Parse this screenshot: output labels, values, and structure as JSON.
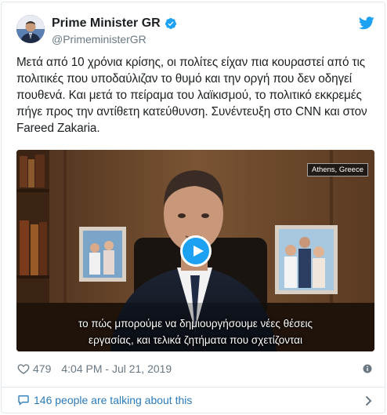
{
  "author": {
    "display_name": "Prime Minister GR",
    "handle": "@PrimeministerGR",
    "verified": true
  },
  "tweet": {
    "text": "Μετά από 10 χρόνια κρίσης, οι πολίτες είχαν πια κουραστεί από τις πολιτικές που υποδαύλιζαν το θυμό και την οργή που δεν οδηγεί πουθενά. Και μετά το πείραμα του λαϊκισμού, το πολιτικό εκκρεμές πήγε προς την αντίθετη κατεύθυνση. Συνέντευξη στο CNN και στον Fareed Zakaria."
  },
  "media": {
    "location_badge": "Athens, Greece",
    "subtitle_line_1": "το πώς μπορούμε να δημιουργήσουμε νέες θέσεις",
    "subtitle_line_2": "εργασίας, και τελικά ζητήματα που σχετίζονται"
  },
  "footer": {
    "like_count": "479",
    "timestamp": "4:04 PM - Jul 21, 2019",
    "talking_label": "146 people are talking about this"
  },
  "colors": {
    "accent": "#1da1f2",
    "link": "#2b7bb9",
    "muted": "#697882",
    "border": "#e1e8ed"
  },
  "icons": {
    "bird": "twitter-bird-icon",
    "verified": "verified-badge-icon",
    "heart": "heart-icon",
    "info": "info-icon",
    "bubble": "speech-bubble-icon",
    "chevron": "chevron-right-icon"
  }
}
